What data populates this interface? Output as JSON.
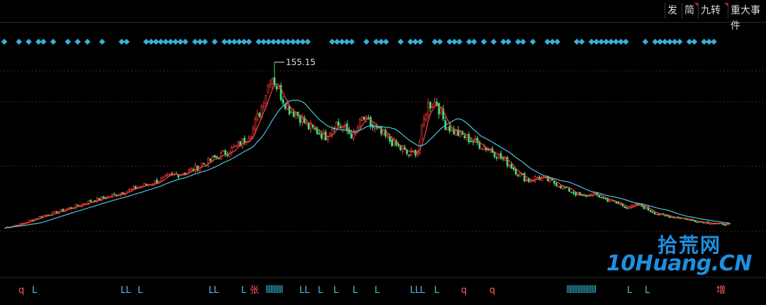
{
  "toolbar": {
    "buttons": [
      {
        "label": "发",
        "marked": false
      },
      {
        "label": "简",
        "marked": true
      },
      {
        "label": "九转",
        "marked": true
      },
      {
        "label": "重大事件",
        "marked": false
      }
    ]
  },
  "watermark": {
    "chinese": "拾荒网",
    "english": "10Huang.CN"
  },
  "colors": {
    "background": "#000000",
    "candle_up": "#ff3b3b",
    "candle_down": "#3ee07a",
    "ma_short": "#ff4040",
    "ma_long": "#4fc3d9",
    "signal_dots": "#3ab0d8",
    "grid": "#5a1a1a"
  },
  "chart_data": {
    "type": "candlestick",
    "title": "",
    "xlabel": "",
    "ylabel": "",
    "grid": true,
    "annotations": [
      {
        "label": "155.15",
        "note": "peak high"
      }
    ],
    "price_path": [
      14,
      16,
      18,
      21,
      24,
      26,
      28,
      31,
      33,
      36,
      38,
      40,
      42,
      45,
      47,
      50,
      52,
      55,
      58,
      60,
      62,
      66,
      70,
      74,
      78,
      82,
      88,
      98,
      118,
      145,
      128,
      115,
      110,
      100,
      96,
      92,
      104,
      98,
      92,
      108,
      100,
      94,
      88,
      82,
      76,
      80,
      118,
      122,
      102,
      96,
      92,
      88,
      84,
      80,
      74,
      68,
      60,
      54,
      57,
      55,
      52,
      48,
      44,
      40,
      43,
      40,
      37,
      34,
      31,
      34,
      30,
      26,
      24,
      23,
      22,
      20,
      19,
      18,
      17,
      17
    ],
    "moving_averages": [
      {
        "name": "",
        "color_key": "ma_short",
        "window": 5
      },
      {
        "name": "",
        "color_key": "ma_long",
        "window": 18
      }
    ],
    "signal_labels": [
      "q",
      "L",
      "LL",
      "L",
      "LL",
      "L",
      "张",
      "LL",
      "L",
      "L",
      "L",
      "L",
      "LL",
      "L",
      "L",
      "q",
      "q",
      "L",
      "L",
      "增"
    ]
  }
}
